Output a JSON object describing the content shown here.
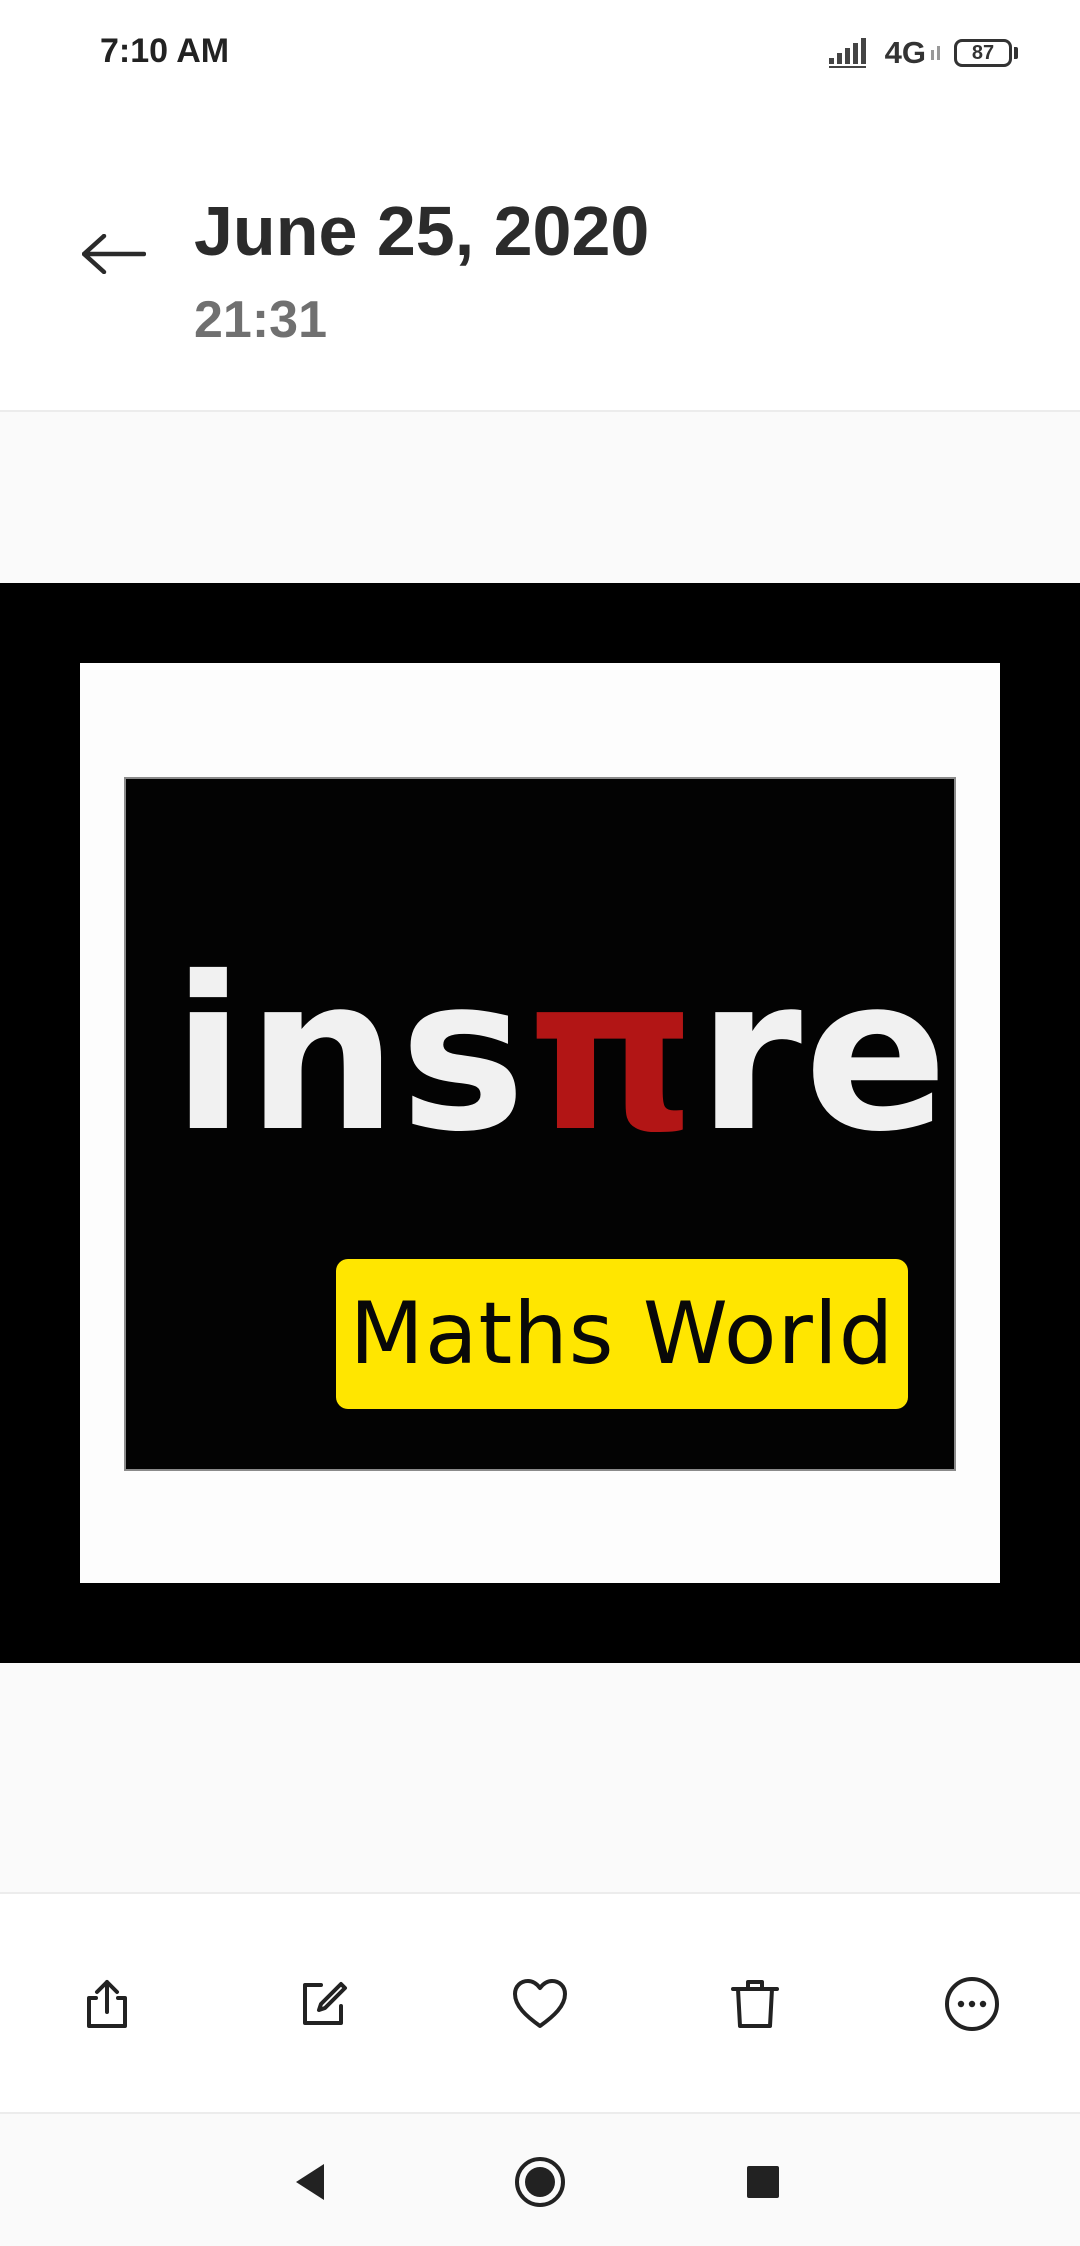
{
  "status_bar": {
    "time": "7:10 AM",
    "network": "4G",
    "battery": "87"
  },
  "header": {
    "date": "June 25, 2020",
    "time": "21:31"
  },
  "photo": {
    "logo_prefix": "ins",
    "logo_pi": "π",
    "logo_suffix": "re",
    "badge_text": "Maths World"
  },
  "colors": {
    "accent_red": "#b21515",
    "badge_yellow": "#ffe600"
  },
  "actions": [
    {
      "icon": "share-icon"
    },
    {
      "icon": "edit-icon"
    },
    {
      "icon": "favorite-heart-icon"
    },
    {
      "icon": "delete-trash-icon"
    },
    {
      "icon": "more-options-icon"
    }
  ],
  "nav": {
    "back_icon": "triangle-back-icon",
    "home_icon": "circle-home-icon",
    "recents_icon": "square-recents-icon"
  }
}
